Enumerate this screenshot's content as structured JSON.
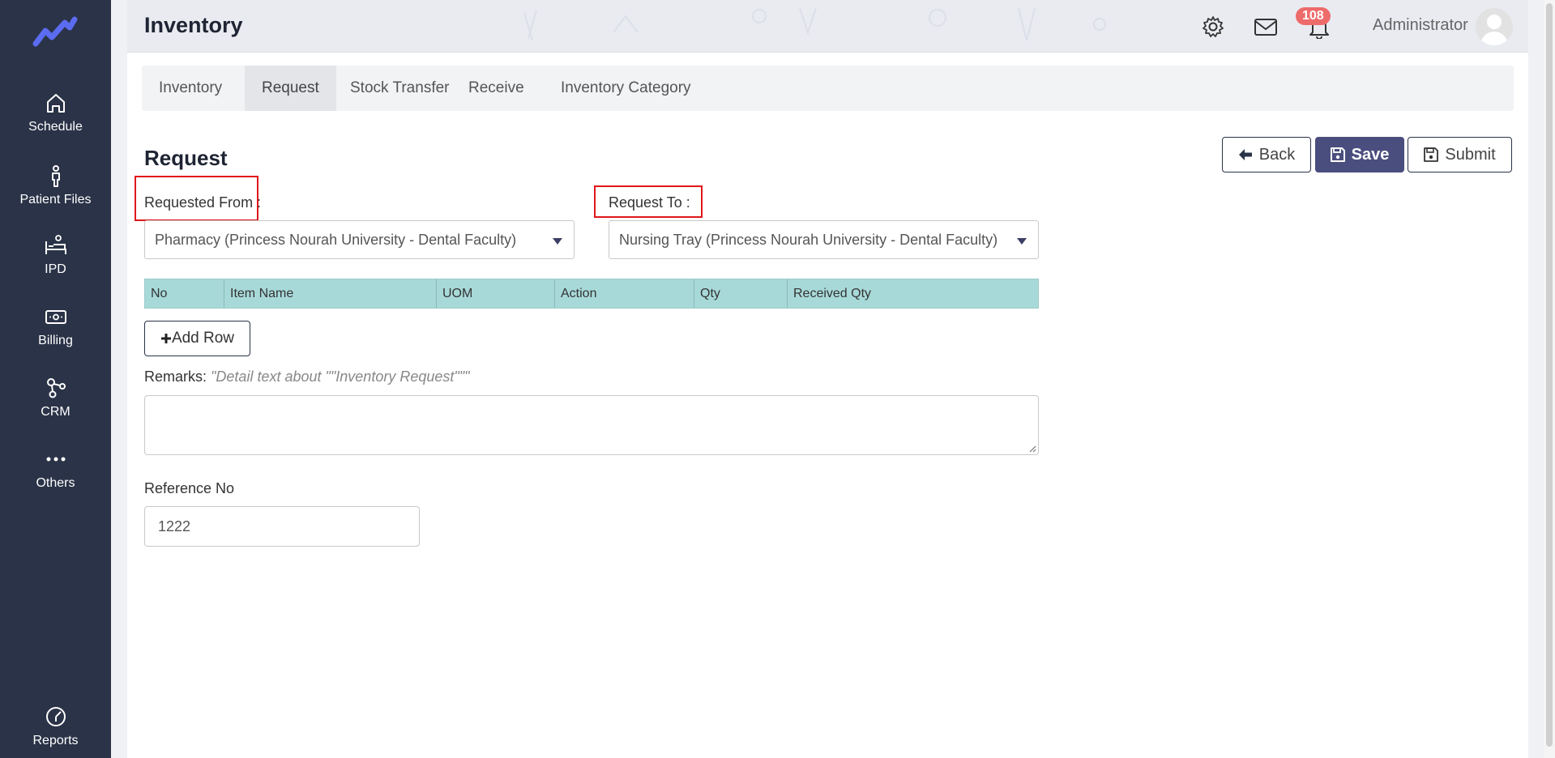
{
  "sidebar": {
    "logo": "app-logo",
    "items": [
      {
        "label": "Schedule",
        "icon": "home-icon"
      },
      {
        "label": "Patient Files",
        "icon": "person-icon"
      },
      {
        "label": "IPD",
        "icon": "bed-icon"
      },
      {
        "label": "Billing",
        "icon": "money-icon"
      },
      {
        "label": "CRM",
        "icon": "crm-icon"
      },
      {
        "label": "Others",
        "icon": "more-icon"
      },
      {
        "label": "Reports",
        "icon": "reports-icon"
      }
    ]
  },
  "header": {
    "title": "Inventory",
    "notification_count": "108",
    "user_name": "Administrator"
  },
  "tabs": [
    {
      "label": "Inventory",
      "active": false
    },
    {
      "label": "Request",
      "active": true
    },
    {
      "label": "Stock Transfer",
      "active": false
    },
    {
      "label": "Receive",
      "active": false
    },
    {
      "label": "Inventory Category",
      "active": false
    }
  ],
  "form": {
    "title": "Request",
    "back_label": "Back",
    "save_label": "Save",
    "submit_label": "Submit",
    "requested_from_label": "Requested From :",
    "requested_from_value": "Pharmacy (Princess Nourah University - Dental Faculty)",
    "request_to_label": "Request To :",
    "request_to_value": "Nursing Tray (Princess Nourah University - Dental Faculty)",
    "columns": [
      "No",
      "Item Name",
      "UOM",
      "Action",
      "Qty",
      "Received Qty"
    ],
    "add_row_label": "Add Row",
    "remarks_label": "Remarks:",
    "remarks_hint": "\"Detail text about \"\"Inventory Request\"\"\"",
    "remarks_value": "",
    "reference_label": "Reference No",
    "reference_value": "1222"
  },
  "colors": {
    "sidebar_bg": "#2a3347",
    "accent": "#4a4e7e",
    "table_header": "#a8d9d9",
    "highlight": "#e0161b",
    "badge": "#ee6b6b"
  }
}
